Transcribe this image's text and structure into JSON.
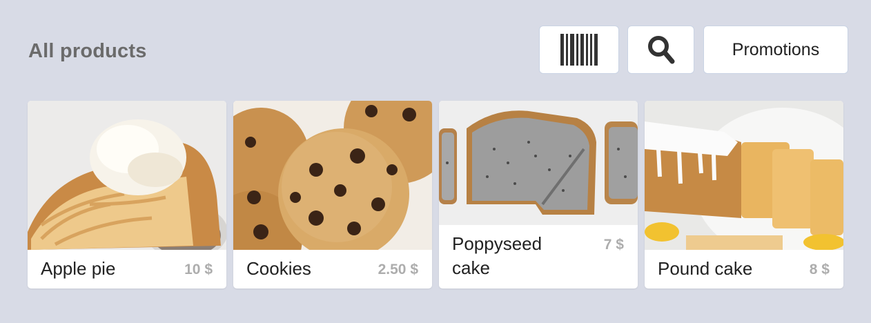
{
  "header": {
    "title": "All products",
    "promotions_label": "Promotions"
  },
  "icons": {
    "barcode": "barcode-icon",
    "search": "search-icon"
  },
  "products": [
    {
      "name": "Apple pie",
      "price": "10 $",
      "image": "apple-pie-image"
    },
    {
      "name": "Cookies",
      "price": "2.50 $",
      "image": "cookies-image"
    },
    {
      "name": "Poppyseed cake",
      "price": "7 $",
      "image": "poppyseed-cake-image"
    },
    {
      "name": "Pound cake",
      "price": "8 $",
      "image": "pound-cake-image"
    }
  ]
}
